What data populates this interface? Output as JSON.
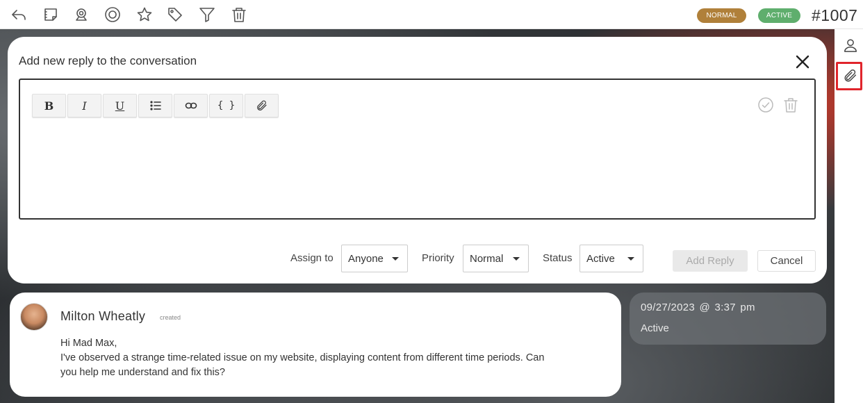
{
  "toolbar": {
    "icons": [
      "reply-icon",
      "note-icon",
      "webcam-icon",
      "target-icon",
      "star-icon",
      "tag-icon",
      "filter-icon",
      "trash-icon"
    ],
    "priority_badge": "NORMAL",
    "status_badge": "ACTIVE",
    "ticket_id": "#1007",
    "colors": {
      "normal_badge": "#b0803a",
      "active_badge": "#5fae6d"
    }
  },
  "sidebar": {
    "icons": [
      "user-icon",
      "paperclip-icon"
    ],
    "highlight_color": "#e0242b"
  },
  "reply_modal": {
    "title": "Add new reply to the conversation",
    "formatting": {
      "bold": "B",
      "italic": "I",
      "underline": "U",
      "code": "{ }"
    },
    "editor_content": "",
    "assign_label": "Assign to",
    "assign_value": "Anyone",
    "priority_label": "Priority",
    "priority_value": "Normal",
    "status_label": "Status",
    "status_value": "Active",
    "add_reply_label": "Add Reply",
    "cancel_label": "Cancel"
  },
  "message": {
    "author": "Milton Wheatly",
    "action": "created",
    "lines": [
      "Hi Mad Max,",
      "I've observed a strange time-related issue on my website, displaying content from different time periods. Can",
      "you help me understand and fix this?"
    ]
  },
  "meta": {
    "datetime": "09/27/2023 @ 3:37 pm",
    "status": "Active"
  }
}
